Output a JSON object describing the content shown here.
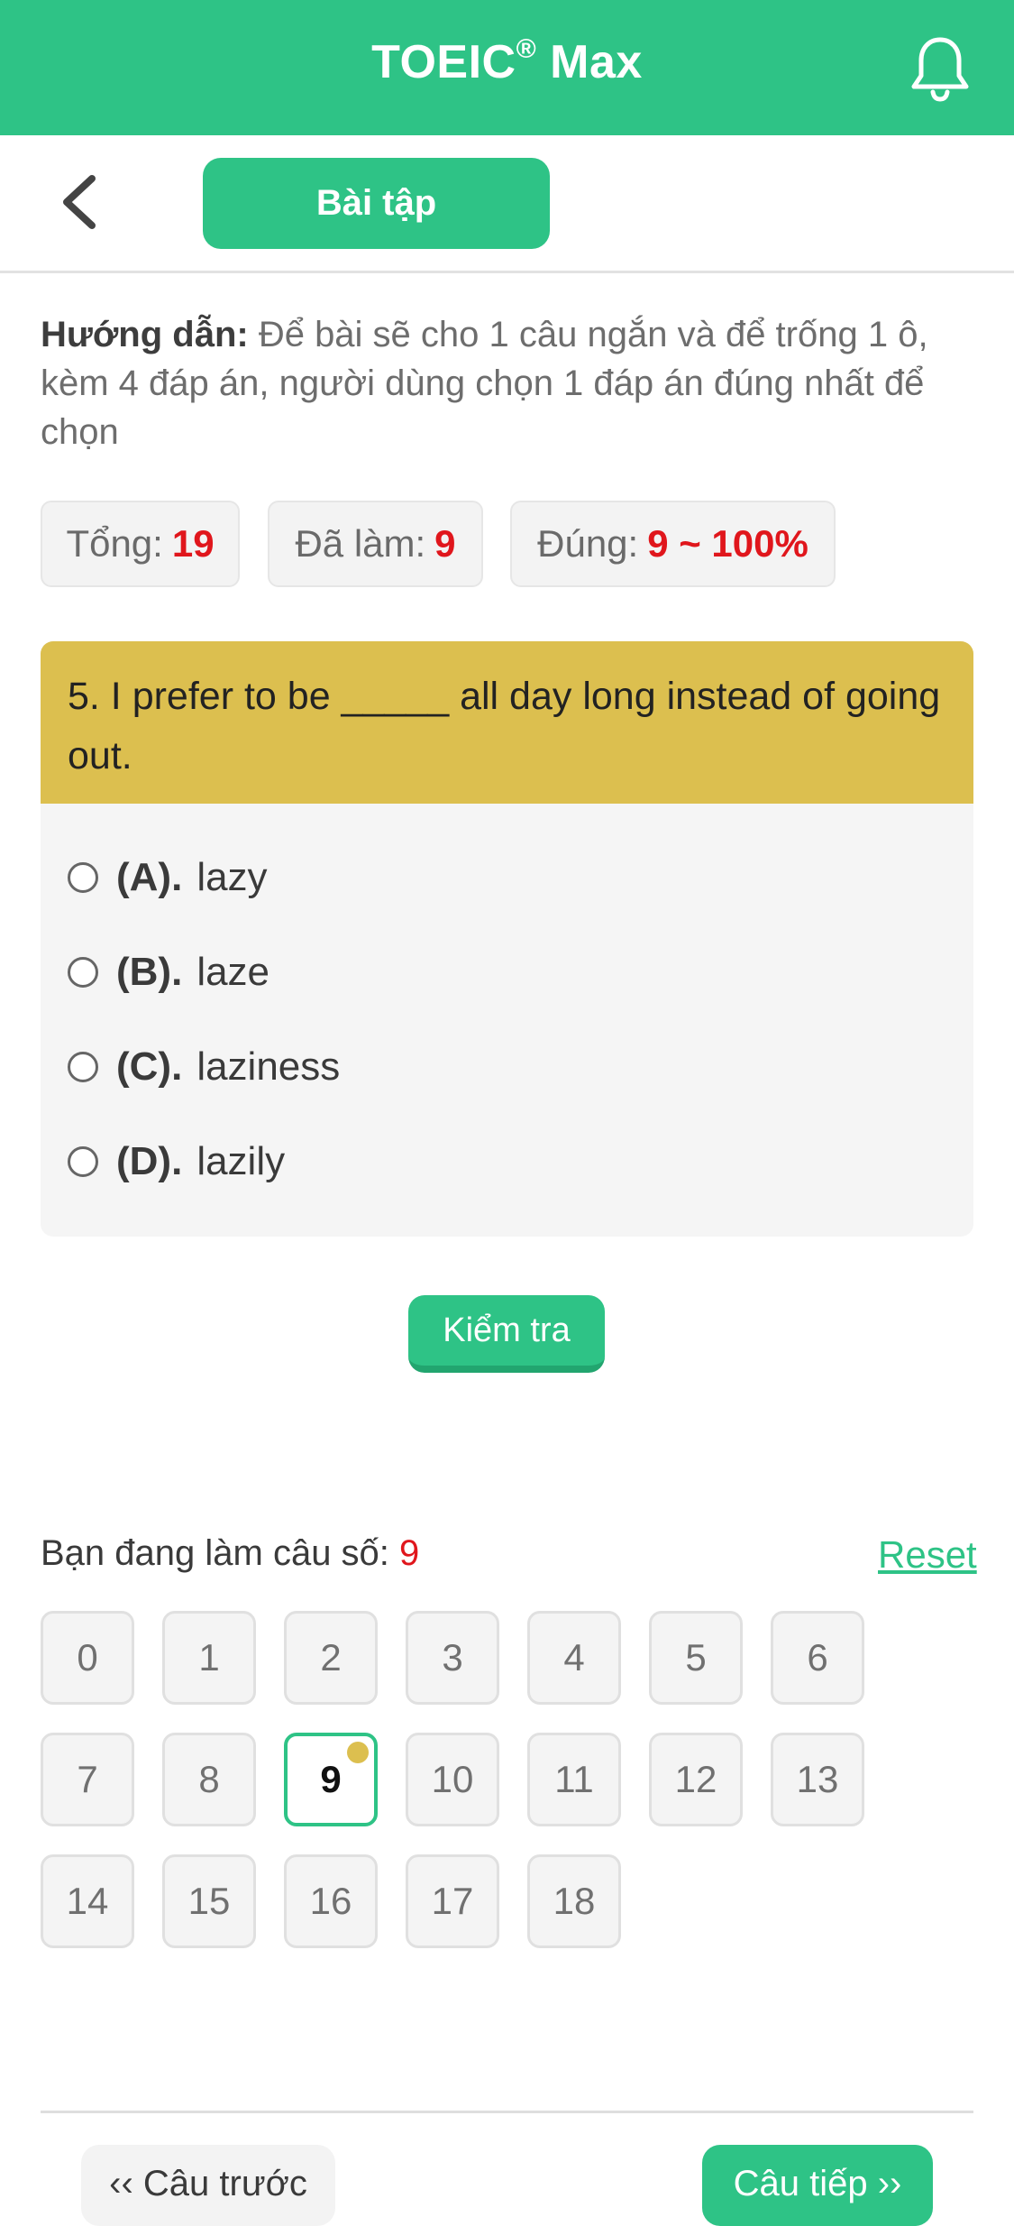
{
  "header": {
    "title": "TOEIC",
    "title_sup": "®",
    "title_suffix": " Max",
    "bell_icon": "bell-icon",
    "accent": "#2ec386"
  },
  "subbar": {
    "back_icon": "chevron-left-icon",
    "tab_label": "Bài tập"
  },
  "instructions": {
    "label": "Hướng dẫn:",
    "text": " Để bài sẽ cho 1 câu ngắn và để trống 1 ô, kèm 4 đáp án, người dùng chọn 1 đáp án đúng nhất để chọn"
  },
  "stats": {
    "total_label": "Tổng:",
    "total_value": "19",
    "done_label": "Đã làm:",
    "done_value": "9",
    "correct_label": "Đúng:",
    "correct_value": "9 ~ 100%"
  },
  "question": {
    "text": "5. I prefer to be _____ all day long instead of going out.",
    "header_color": "#dcbf4f",
    "options": [
      {
        "letter": "(A).",
        "text": "lazy"
      },
      {
        "letter": "(B).",
        "text": "laze"
      },
      {
        "letter": "(C).",
        "text": "laziness"
      },
      {
        "letter": "(D).",
        "text": "lazily"
      }
    ]
  },
  "check_button": "Kiểm tra",
  "progress": {
    "current_label": "Bạn đang làm câu số:",
    "current_number": "9",
    "reset_label": "Reset",
    "cells": [
      "0",
      "1",
      "2",
      "3",
      "4",
      "5",
      "6",
      "7",
      "8",
      "9",
      "10",
      "11",
      "12",
      "13",
      "14",
      "15",
      "16",
      "17",
      "18"
    ],
    "active_cell": "9"
  },
  "nav": {
    "prev_label": "‹‹ Câu trước",
    "next_label": "Câu tiếp ››"
  }
}
